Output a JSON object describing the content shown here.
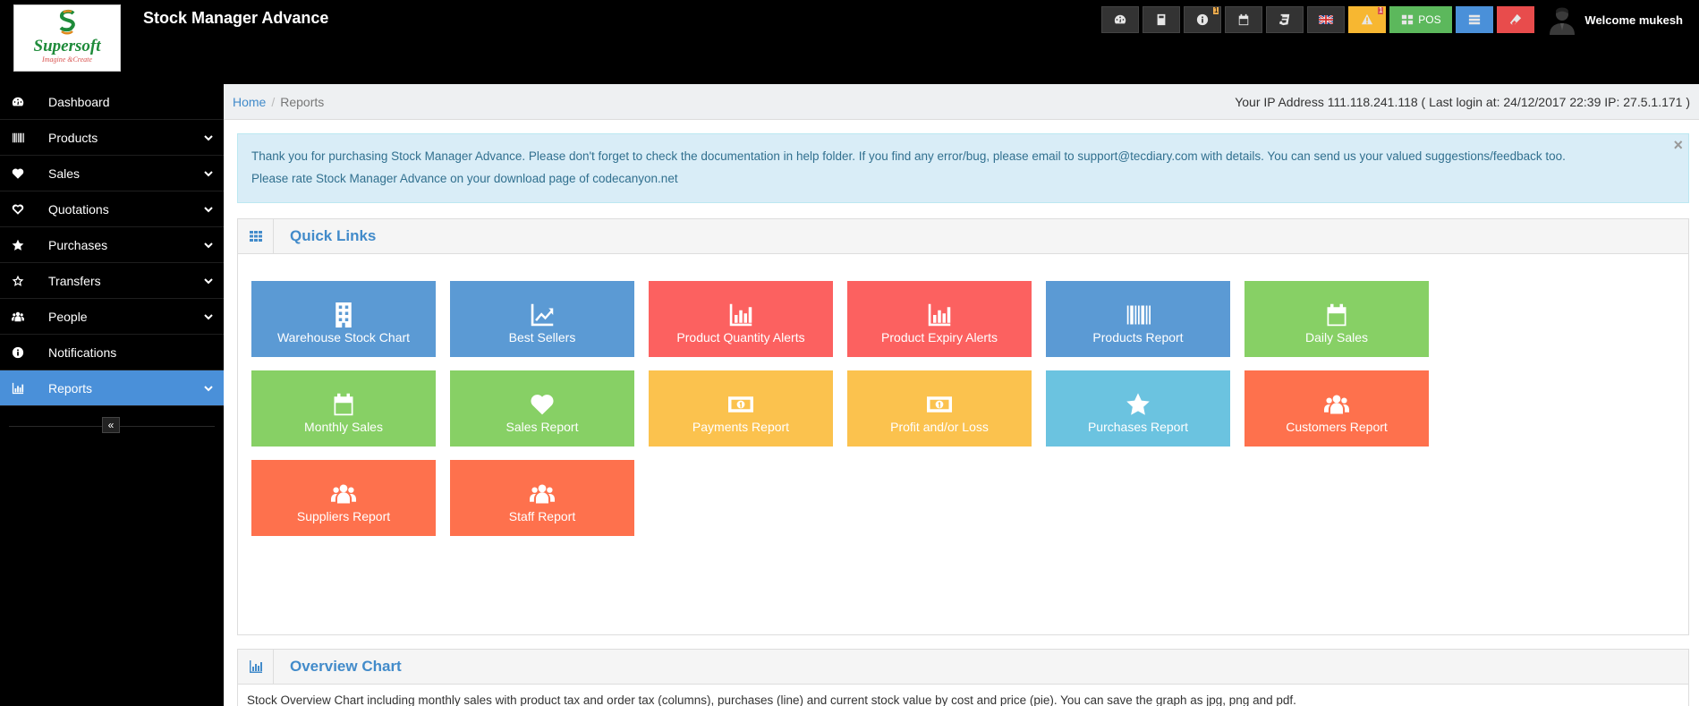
{
  "app": {
    "title": "Stock Manager Advance",
    "logo_text": "Supersoft",
    "logo_tagline": "Imagine &Create"
  },
  "header": {
    "buttons": [
      {
        "name": "dashboard-button",
        "icon": "dashboard-icon"
      },
      {
        "name": "calculator-button",
        "icon": "calculator-icon"
      },
      {
        "name": "info-button",
        "icon": "info-icon",
        "badge": "1"
      },
      {
        "name": "calendar-button",
        "icon": "calendar-icon"
      },
      {
        "name": "styles-button",
        "icon": "css3-icon"
      },
      {
        "name": "language-button",
        "icon": "uk-flag-icon"
      },
      {
        "name": "alerts-button",
        "icon": "warning-icon",
        "badge": "1"
      },
      {
        "name": "pos-button",
        "icon": "th-large-icon",
        "label": "POS"
      },
      {
        "name": "list-button",
        "icon": "list-icon"
      },
      {
        "name": "clear-button",
        "icon": "eraser-icon"
      }
    ],
    "pos_label": "POS",
    "info_badge": "1",
    "alert_badge": "1",
    "welcome": "Welcome mukesh"
  },
  "sidebar": {
    "items": [
      {
        "label": "Dashboard",
        "icon": "dashboard-icon",
        "expandable": false
      },
      {
        "label": "Products",
        "icon": "barcode-icon",
        "expandable": true
      },
      {
        "label": "Sales",
        "icon": "heart-icon",
        "expandable": true
      },
      {
        "label": "Quotations",
        "icon": "heart-outline-icon",
        "expandable": true
      },
      {
        "label": "Purchases",
        "icon": "star-icon",
        "expandable": true
      },
      {
        "label": "Transfers",
        "icon": "star-outline-icon",
        "expandable": true
      },
      {
        "label": "People",
        "icon": "users-icon",
        "expandable": true
      },
      {
        "label": "Notifications",
        "icon": "info-icon",
        "expandable": false
      },
      {
        "label": "Reports",
        "icon": "bar-chart-icon",
        "expandable": true,
        "active": true
      }
    ],
    "collapse_label": "«"
  },
  "breadcrumb": {
    "home": "Home",
    "separator": "/",
    "current": "Reports"
  },
  "ip_info": "Your IP Address 111.118.241.118 ( Last login at: 24/12/2017 22:39 IP: 27.5.1.171 )",
  "alert": {
    "line1": "Thank you for purchasing Stock Manager Advance. Please don't forget to check the documentation in help folder. If you find any error/bug, please email to support@tecdiary.com with details. You can send us your valued suggestions/feedback too.",
    "line2": "Please rate Stock Manager Advance on your download page of codecanyon.net",
    "close": "×"
  },
  "quick_links": {
    "title": "Quick Links",
    "tiles": [
      {
        "label": "Warehouse Stock Chart",
        "icon": "building-icon",
        "color": "#5b9ad4"
      },
      {
        "label": "Best Sellers",
        "icon": "line-chart-icon",
        "color": "#5b9ad4"
      },
      {
        "label": "Product Quantity Alerts",
        "icon": "bar-chart-icon",
        "color": "#fc6160"
      },
      {
        "label": "Product Expiry Alerts",
        "icon": "bar-chart-icon",
        "color": "#fc6160"
      },
      {
        "label": "Products Report",
        "icon": "barcode-icon",
        "color": "#5b9ad4"
      },
      {
        "label": "Daily Sales",
        "icon": "calendar-icon",
        "color": "#87d065"
      },
      {
        "label": "Monthly Sales",
        "icon": "calendar-icon",
        "color": "#87d065"
      },
      {
        "label": "Sales Report",
        "icon": "heart-icon",
        "color": "#87d065"
      },
      {
        "label": "Payments Report",
        "icon": "money-icon",
        "color": "#fbc24e"
      },
      {
        "label": "Profit and/or Loss",
        "icon": "money-icon",
        "color": "#fbc24e"
      },
      {
        "label": "Purchases Report",
        "icon": "star-icon",
        "color": "#6bc3e0"
      },
      {
        "label": "Customers Report",
        "icon": "users-icon",
        "color": "#fe714d"
      },
      {
        "label": "Suppliers Report",
        "icon": "users-icon",
        "color": "#fe714d"
      },
      {
        "label": "Staff Report",
        "icon": "users-icon",
        "color": "#fe714d"
      }
    ]
  },
  "overview": {
    "title": "Overview Chart",
    "text": "Stock Overview Chart including monthly sales with product tax and order tax (columns), purchases (line) and current stock value by cost and price (pie). You can save the graph as jpg, png and pdf."
  }
}
